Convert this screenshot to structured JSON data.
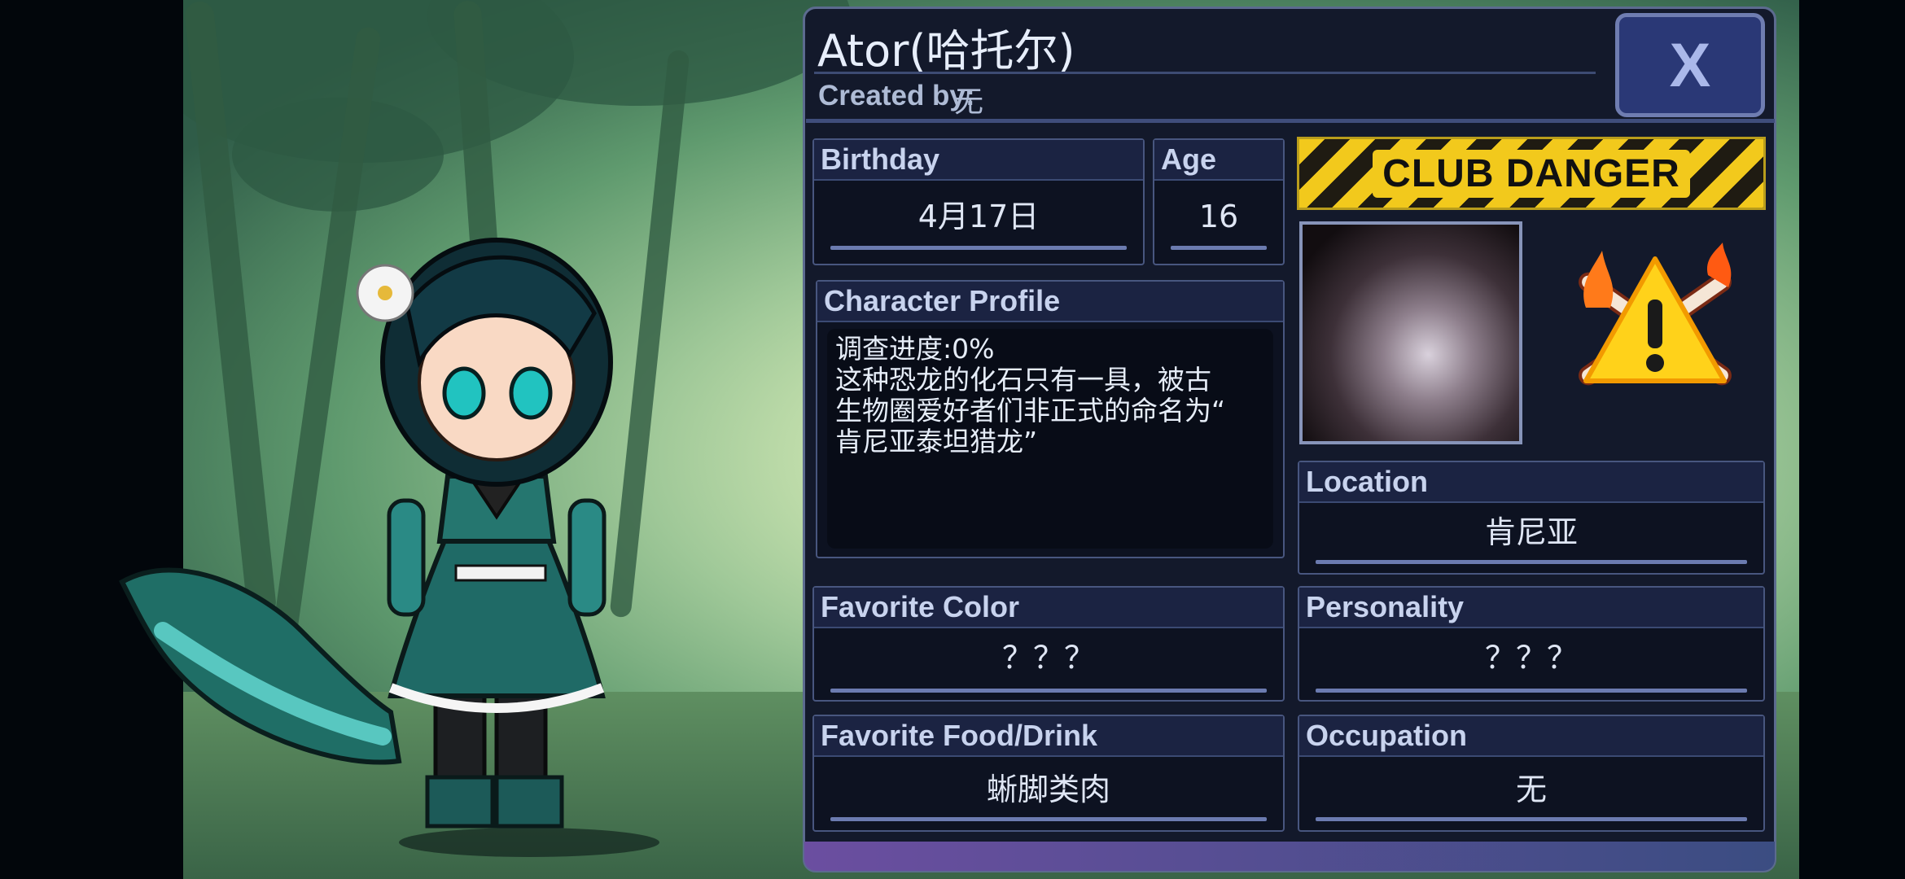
{
  "profile": {
    "name": "Ator(哈托尔)",
    "created_by_label": "Created by:",
    "created_by_value": "无",
    "close_label": "X"
  },
  "fields": {
    "birthday": {
      "label": "Birthday",
      "value": "4月17日"
    },
    "age": {
      "label": "Age",
      "value": "16"
    },
    "character_profile": {
      "label": "Character Profile",
      "text": "调查进度:0%\n这种恐龙的化石只有一具，被古\n生物圈爱好者们非正式的命名为“\n肯尼亚泰坦猎龙”"
    },
    "location": {
      "label": "Location",
      "value": "肯尼亚"
    },
    "favorite_color": {
      "label": "Favorite Color",
      "value": "？？？"
    },
    "personality": {
      "label": "Personality",
      "value": "？？？"
    },
    "favorite_food": {
      "label": "Favorite Food/Drink",
      "value": "蜥脚类肉"
    },
    "occupation": {
      "label": "Occupation",
      "value": "无"
    }
  },
  "club": {
    "banner_text": "CLUB DANGER",
    "icon": "warning-skull-icon"
  },
  "colors": {
    "panel_bg": "#13192b",
    "label_bg": "#1b2342",
    "accent": "#6b7bb0",
    "close_bg": "#2a3876"
  }
}
